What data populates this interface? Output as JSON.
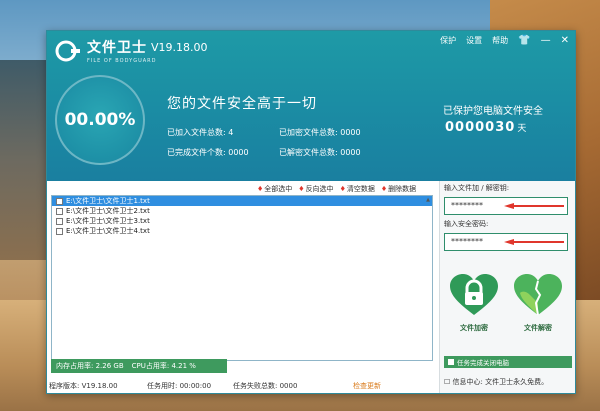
{
  "app": {
    "title": "文件卫士",
    "subtitle": "FILE OF BODYGUARD",
    "version": "V19.18.00",
    "menu": {
      "protect": "保护",
      "settings": "设置",
      "help": "帮助"
    },
    "window_controls": {
      "skin": "👕",
      "minimize": "—",
      "close": "✕"
    }
  },
  "header": {
    "percent": "00.00%",
    "slogan": "您的文件安全高于一切",
    "stats": {
      "added_label": "已加入文件总数:",
      "added_value": "4",
      "encrypted_label": "已加密文件总数:",
      "encrypted_value": "0000",
      "completed_label": "已完成文件个数:",
      "completed_value": "0000",
      "decrypted_label": "已解密文件总数:",
      "decrypted_value": "0000"
    },
    "protect_label": "已保护您电脑文件安全",
    "protect_days": "0000030",
    "protect_days_unit": "天"
  },
  "actions": {
    "select_all": "全部选中",
    "invert": "反向选中",
    "clear": "清空数据",
    "delete": "删除数据"
  },
  "files": [
    {
      "path": "E:\\文件卫士\\文件卫士1.txt",
      "selected": true
    },
    {
      "path": "E:\\文件卫士\\文件卫士2.txt",
      "selected": false
    },
    {
      "path": "E:\\文件卫士\\文件卫士3.txt",
      "selected": false
    },
    {
      "path": "E:\\文件卫士\\文件卫士4.txt",
      "selected": false
    }
  ],
  "sysinfo": {
    "mem": "内存占用率: 2.26 GB",
    "cpu": "CPU占用率: 4.21 %"
  },
  "status": {
    "program_version": "程序版本: V19.18.00",
    "task_time": "任务用时: 00:00:00",
    "task_fail": "任务失败总数: 0000",
    "check_update": "检查更新"
  },
  "right": {
    "enc_pwd_label": "输入文件加 / 解密钥:",
    "enc_pwd_value": "********",
    "safe_pwd_label": "输入安全密码:",
    "safe_pwd_value": "********",
    "encrypt_label": "文件加密",
    "decrypt_label": "文件解密",
    "auto_shutdown": "任务完成关闭电脑",
    "info_center": "信息中心: 文件卫士永久免费。"
  },
  "colors": {
    "header": "#1b8ea4",
    "accent_green": "#3e9a5e",
    "arrow_red": "#e0362c",
    "selection": "#2f8ee0"
  }
}
